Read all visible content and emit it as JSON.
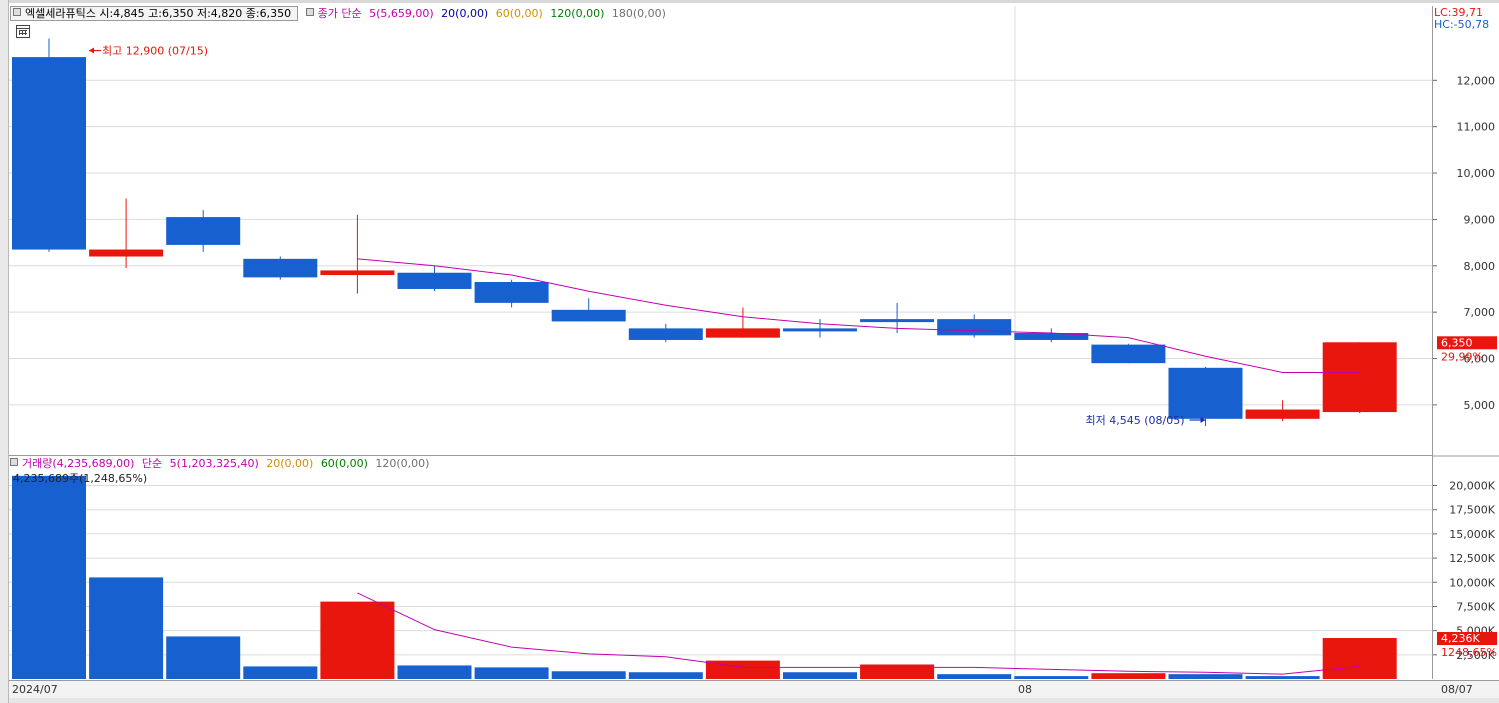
{
  "price_header": {
    "info": "엑셀세라퓨틱스 시:4,845 고:6,350 저:4,820 종:6,350",
    "ma_title": "종가 단순",
    "ma5": "5(5,659,00)",
    "ma20": "20(0,00)",
    "ma60": "60(0,00)",
    "ma120": "120(0,00)",
    "ma180": "180(0,00)"
  },
  "volume_header": {
    "title": "거래량(4,235,689,00)",
    "ma_title": "단순",
    "ma5": "5(1,203,325,40)",
    "ma20": "20(0,00)",
    "ma60": "60(0,00)",
    "ma120": "120(0,00)"
  },
  "annotations": {
    "high": "최고 12,900 (07/15)",
    "low": "최저 4,545 (08/05)",
    "lc": "LC:39,71",
    "hc": "HC:-50,78",
    "price_tag": "6,350",
    "price_pct": "29,99%",
    "vol_first_label": "4,235,689주(1,248,65%)",
    "vol_tag": "4,236K",
    "vol_pct": "1248,65%"
  },
  "x_axis": {
    "start": "2024/07",
    "mid": "08",
    "end": "08/07"
  },
  "colors": {
    "up": "#e8160c",
    "down": "#1660d0",
    "ma5": "#c400b0",
    "grid": "#dcdcdc",
    "ma20": "#0000a0",
    "ma60": "#d09000",
    "ma120": "#008000",
    "ma180": "#707070"
  },
  "chart_data": [
    {
      "type": "candlestick",
      "ylim": [
        4200,
        13300
      ],
      "y_ticks": [
        5000,
        6000,
        7000,
        8000,
        9000,
        10000,
        11000,
        12000
      ],
      "y_tick_labels": [
        "5,000",
        "6,000",
        "7,000",
        "8,000",
        "9,000",
        "10,000",
        "11,000",
        "12,000"
      ],
      "candles": [
        {
          "o": 12500,
          "h": 12900,
          "l": 8300,
          "c": 8350
        },
        {
          "o": 8200,
          "h": 9450,
          "l": 7950,
          "c": 8350
        },
        {
          "o": 9050,
          "h": 9200,
          "l": 8300,
          "c": 8450
        },
        {
          "o": 8150,
          "h": 8200,
          "l": 7700,
          "c": 7750
        },
        {
          "o": 7800,
          "h": 9100,
          "l": 7400,
          "c": 7900
        },
        {
          "o": 7850,
          "h": 8000,
          "l": 7450,
          "c": 7500
        },
        {
          "o": 7650,
          "h": 7700,
          "l": 7100,
          "c": 7200
        },
        {
          "o": 7050,
          "h": 7300,
          "l": 6800,
          "c": 6800
        },
        {
          "o": 6650,
          "h": 6750,
          "l": 6350,
          "c": 6400
        },
        {
          "o": 6450,
          "h": 7100,
          "l": 6450,
          "c": 6650
        },
        {
          "o": 6650,
          "h": 6850,
          "l": 6450,
          "c": 6600
        },
        {
          "o": 6850,
          "h": 7200,
          "l": 6550,
          "c": 6800
        },
        {
          "o": 6850,
          "h": 6950,
          "l": 6450,
          "c": 6500
        },
        {
          "o": 6550,
          "h": 6650,
          "l": 6350,
          "c": 6400
        },
        {
          "o": 6300,
          "h": 6320,
          "l": 5900,
          "c": 5900
        },
        {
          "o": 5800,
          "h": 5820,
          "l": 4545,
          "c": 4700
        },
        {
          "o": 4700,
          "h": 5100,
          "l": 4650,
          "c": 4900
        },
        {
          "o": 4845,
          "h": 6350,
          "l": 4820,
          "c": 6350
        }
      ],
      "ma5": [
        null,
        null,
        null,
        null,
        8150,
        8000,
        7800,
        7450,
        7150,
        6900,
        6750,
        6650,
        6600,
        6550,
        6450,
        6050,
        5700,
        5700
      ]
    },
    {
      "type": "bar",
      "ylim": [
        0,
        21500
      ],
      "y_ticks": [
        2500,
        5000,
        7500,
        10000,
        12500,
        15000,
        17500,
        20000
      ],
      "y_tick_labels": [
        "2,500K",
        "5,000K",
        "7,500K",
        "10,000K",
        "12,500K",
        "15,000K",
        "17,500K",
        "20,000K"
      ],
      "values": [
        21000,
        10500,
        4400,
        1300,
        8000,
        1400,
        1200,
        800,
        700,
        1900,
        700,
        1500,
        500,
        300,
        600,
        500,
        300,
        4236
      ],
      "colors": [
        "down",
        "down",
        "down",
        "down",
        "up",
        "down",
        "down",
        "down",
        "down",
        "up",
        "down",
        "up",
        "down",
        "down",
        "up",
        "down",
        "down",
        "up"
      ],
      "ma5": [
        null,
        null,
        null,
        null,
        8900,
        5100,
        3300,
        2600,
        2300,
        1200,
        1200,
        1200,
        1200,
        1000,
        800,
        700,
        500,
        1300
      ]
    }
  ]
}
